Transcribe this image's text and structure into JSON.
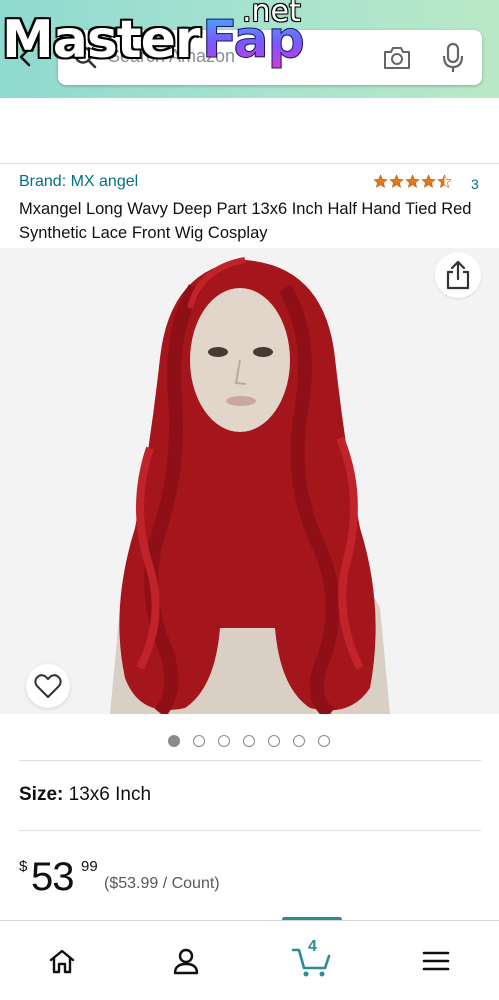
{
  "header": {
    "search_placeholder": "Search Amazon"
  },
  "watermark": {
    "master": "Master",
    "fap": "Fap",
    "net": ".net"
  },
  "product": {
    "brand": "Brand: MX angel",
    "rating_count": "3",
    "rating_value": 4.5,
    "title": "Mxangel Long Wavy Deep Part 13x6 Inch Half Hand Tied Red Synthetic Lace Front Wig Cosplay",
    "image_count": 7,
    "active_image": 1
  },
  "size": {
    "label": "Size:",
    "value": "13x6 Inch"
  },
  "price": {
    "currency": "$",
    "whole": "53",
    "fraction": "99",
    "per_unit": "($53.99 / Count)"
  },
  "bottom_nav": {
    "cart_count": "4",
    "items": [
      "home-icon",
      "account-icon",
      "cart-icon",
      "menu-icon"
    ]
  },
  "colors": {
    "link": "#007185",
    "star": "#de7921",
    "accent": "#2b8c96",
    "header_gradient_start": "#8fd9d0",
    "header_gradient_end": "#b9e8c6"
  }
}
